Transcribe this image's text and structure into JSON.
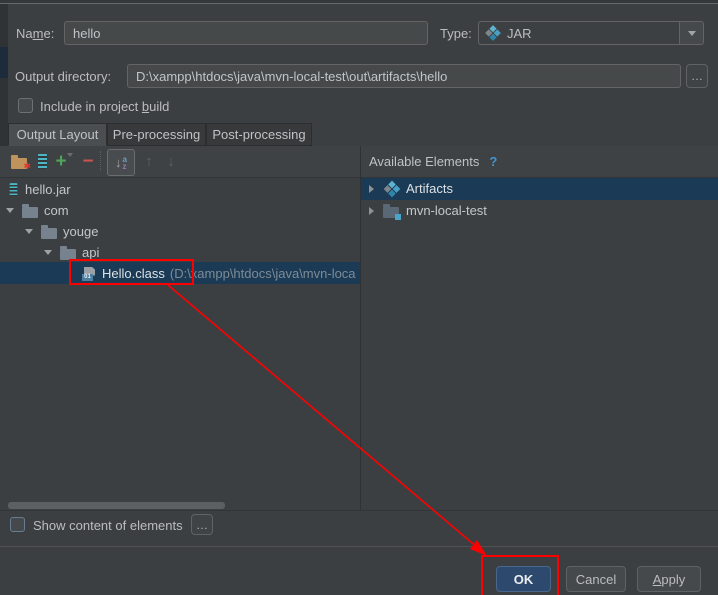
{
  "annotations": {
    "color": "#ff0000"
  },
  "form": {
    "name_label": {
      "pre": "Na",
      "mn": "m",
      "post": "e:"
    },
    "name_value": "hello",
    "type_label": "Type:",
    "type_value": "JAR",
    "output_dir_label": "Output directory:",
    "output_dir_value": "D:\\xampp\\htdocs\\java\\mvn-local-test\\out\\artifacts\\hello",
    "browse_button": "…",
    "include_checkbox": {
      "pre": "Include in project ",
      "mn": "b",
      "post": "uild"
    }
  },
  "tabs": {
    "active": "Output Layout",
    "items": [
      "Output Layout",
      "Pre-processing",
      "Post-processing"
    ]
  },
  "toolbar": {
    "icons": [
      "new-folder",
      "create-archive",
      "add",
      "remove",
      "sort-alphabetically",
      "move-up",
      "move-down"
    ],
    "add_glyph": "+",
    "remove_glyph": "−",
    "sort_arrow_glyph": "↓",
    "sort_a": "a",
    "sort_z": "z",
    "up_glyph": "↑",
    "down_glyph": "↓"
  },
  "left_tree": {
    "class_badge": "01",
    "rows": [
      {
        "label": "hello.jar"
      },
      {
        "label": "com"
      },
      {
        "label": "youge"
      },
      {
        "label": "api"
      },
      {
        "label": "Hello.class",
        "sublabel": "(D:\\xampp\\htdocs\\java\\mvn-loca",
        "selected": true
      }
    ]
  },
  "right_panel": {
    "header": "Available Elements",
    "help": "?",
    "rows": [
      {
        "label": "Artifacts",
        "selected": true
      },
      {
        "label": "mvn-local-test"
      }
    ]
  },
  "bottom": {
    "show_content_label": "Show content of elements",
    "more_button": "…"
  },
  "footer": {
    "ok": "OK",
    "cancel": "Cancel",
    "apply": {
      "mn": "A",
      "post": "pply"
    }
  }
}
